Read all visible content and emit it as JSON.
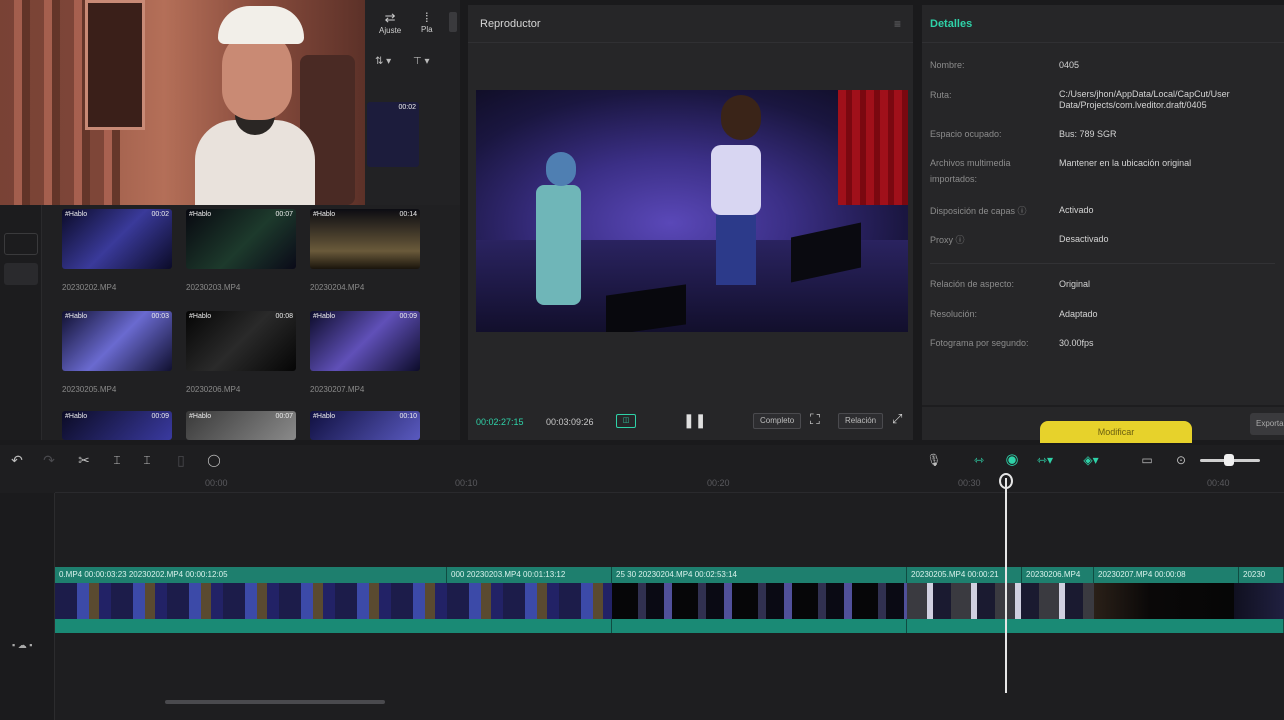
{
  "media": {
    "toolbar": {
      "adjust_label": "Ajuste",
      "more_label": "Pla"
    },
    "thumbs": [
      {
        "tag": "",
        "duration": "00:02",
        "name": ""
      },
      {
        "tag": "#Hablo",
        "duration": "00:02",
        "name": "20230202.MP4"
      },
      {
        "tag": "#Hablo",
        "duration": "00:07",
        "name": "20230203.MP4"
      },
      {
        "tag": "#Hablo",
        "duration": "00:14",
        "name": "20230204.MP4"
      },
      {
        "tag": "#Hablo",
        "duration": "00:03",
        "name": "20230205.MP4"
      },
      {
        "tag": "#Hablo",
        "duration": "00:08",
        "name": "20230206.MP4"
      },
      {
        "tag": "#Hablo",
        "duration": "00:09",
        "name": "20230207.MP4"
      },
      {
        "tag": "#Hablo",
        "duration": "00:09",
        "name": ""
      },
      {
        "tag": "#Hablo",
        "duration": "00:07",
        "name": ""
      },
      {
        "tag": "#Hablo",
        "duration": "00:10",
        "name": ""
      }
    ]
  },
  "player": {
    "title": "Reproductor",
    "timecode_current": "00:02:27:15",
    "timecode_total": "00:03:09:26",
    "full_label": "Completo",
    "ratio_label": "Relación"
  },
  "details": {
    "title": "Detalles",
    "rows": [
      {
        "label": "Nombre:",
        "value": "0405"
      },
      {
        "label": "Ruta:",
        "value": "C:/Users/jhon/AppData/Local/CapCut/User Data/Projects/com.lveditor.draft/0405"
      },
      {
        "label": "Espacio ocupado:",
        "value": "Bus: 789 SGR"
      },
      {
        "label": "Archivos multimedia importados:",
        "value": "Mantener en la ubicación original"
      },
      {
        "label": "Disposición de capas ⓘ",
        "value": "Activado"
      },
      {
        "label": "Proxy ⓘ",
        "value": "Desactivado"
      },
      {
        "label": "Relación de aspecto:",
        "value": "Original"
      },
      {
        "label": "Resolución:",
        "value": "Adaptado"
      },
      {
        "label": "Fotograma por segundo:",
        "value": "30.00fps"
      }
    ],
    "export_label": "Modificar",
    "side_label": "Exportar"
  },
  "timeline": {
    "ruler": [
      "00:00",
      "00:10",
      "00:20",
      "00:30",
      "00:40"
    ],
    "clips": [
      {
        "label": "0.MP4  00:00:03:23  20230202.MP4  00:00:12:05"
      },
      {
        "label": "000  20230203.MP4  00:01:13:12"
      },
      {
        "label": "25  30  20230204.MP4  00:02:53:14"
      },
      {
        "label": "20230205.MP4  00:00:21"
      },
      {
        "label": "20230206.MP4"
      },
      {
        "label": "20230207.MP4  00:00:08"
      },
      {
        "label": "20230"
      }
    ]
  },
  "colors": {
    "accent": "#2fd2a8",
    "clip_bg": "#1e7f6e",
    "export": "#e7d22b"
  }
}
